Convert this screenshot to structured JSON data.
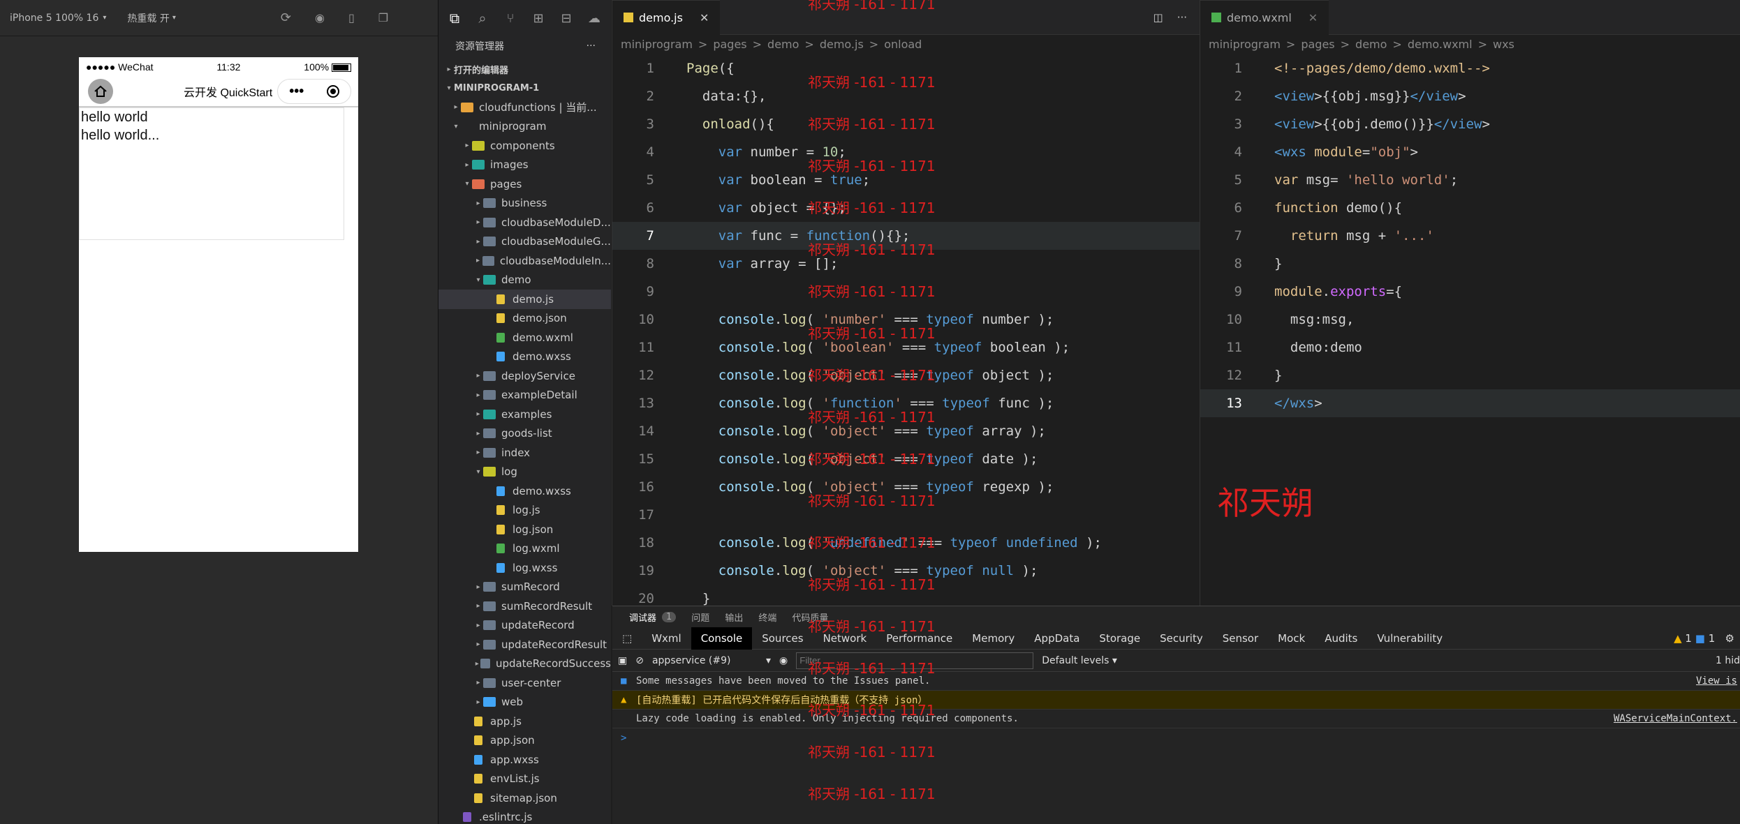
{
  "simulator": {
    "device": "iPhone 5 100% 16",
    "hot_reload": "热重载 开",
    "status_left": "●●●●● WeChat",
    "time": "11:32",
    "battery": "100%",
    "nav_title": "云开发 QuickStart",
    "capsule_menu": "•••",
    "content_lines": [
      "hello world",
      "hello world..."
    ]
  },
  "explorer": {
    "title": "资源管理器",
    "open_editors": "打开的编辑器",
    "project": "MINIPROGRAM-1",
    "items": [
      {
        "label": "cloudfunctions | 当前...",
        "depth": 1,
        "caret": "▸",
        "icon": "folder-cloud",
        "color": "#e8a33c"
      },
      {
        "label": "miniprogram",
        "depth": 1,
        "caret": "▾",
        "icon": "folder",
        "color": ""
      },
      {
        "label": "components",
        "depth": 2,
        "caret": "▸",
        "icon": "folder-components",
        "color": "#c4c42a"
      },
      {
        "label": "images",
        "depth": 2,
        "caret": "▸",
        "icon": "folder-images",
        "color": "#26a69a"
      },
      {
        "label": "pages",
        "depth": 2,
        "caret": "▾",
        "icon": "folder-pages",
        "color": "#e06c4c"
      },
      {
        "label": "business",
        "depth": 3,
        "caret": "▸",
        "icon": "folder",
        "color": "#6b7a8c"
      },
      {
        "label": "cloudbaseModuleD...",
        "depth": 3,
        "caret": "▸",
        "icon": "folder",
        "color": "#6b7a8c"
      },
      {
        "label": "cloudbaseModuleG...",
        "depth": 3,
        "caret": "▸",
        "icon": "folder",
        "color": "#6b7a8c"
      },
      {
        "label": "cloudbaseModuleIn...",
        "depth": 3,
        "caret": "▸",
        "icon": "folder",
        "color": "#6b7a8c"
      },
      {
        "label": "demo",
        "depth": 3,
        "caret": "▾",
        "icon": "folder-demo",
        "color": "#26a69a"
      },
      {
        "label": "demo.js",
        "depth": 4,
        "caret": "",
        "icon": "js-file",
        "color": "#e8c43c",
        "selected": true
      },
      {
        "label": "demo.json",
        "depth": 4,
        "caret": "",
        "icon": "json-file",
        "color": "#e8c43c"
      },
      {
        "label": "demo.wxml",
        "depth": 4,
        "caret": "",
        "icon": "wxml-file",
        "color": "#4caf50"
      },
      {
        "label": "demo.wxss",
        "depth": 4,
        "caret": "",
        "icon": "css-file",
        "color": "#42a5f5"
      },
      {
        "label": "deployService",
        "depth": 3,
        "caret": "▸",
        "icon": "folder",
        "color": "#6b7a8c"
      },
      {
        "label": "exampleDetail",
        "depth": 3,
        "caret": "▸",
        "icon": "folder",
        "color": "#6b7a8c"
      },
      {
        "label": "examples",
        "depth": 3,
        "caret": "▸",
        "icon": "folder-examples",
        "color": "#26a69a"
      },
      {
        "label": "goods-list",
        "depth": 3,
        "caret": "▸",
        "icon": "folder",
        "color": "#6b7a8c"
      },
      {
        "label": "index",
        "depth": 3,
        "caret": "▸",
        "icon": "folder",
        "color": "#6b7a8c"
      },
      {
        "label": "log",
        "depth": 3,
        "caret": "▾",
        "icon": "folder-log",
        "color": "#c4c42a"
      },
      {
        "label": "demo.wxss",
        "depth": 4,
        "caret": "",
        "icon": "css-file",
        "color": "#42a5f5"
      },
      {
        "label": "log.js",
        "depth": 4,
        "caret": "",
        "icon": "js-file",
        "color": "#e8c43c"
      },
      {
        "label": "log.json",
        "depth": 4,
        "caret": "",
        "icon": "json-file",
        "color": "#e8c43c"
      },
      {
        "label": "log.wxml",
        "depth": 4,
        "caret": "",
        "icon": "wxml-file",
        "color": "#4caf50"
      },
      {
        "label": "log.wxss",
        "depth": 4,
        "caret": "",
        "icon": "css-file",
        "color": "#42a5f5"
      },
      {
        "label": "sumRecord",
        "depth": 3,
        "caret": "▸",
        "icon": "folder",
        "color": "#6b7a8c"
      },
      {
        "label": "sumRecordResult",
        "depth": 3,
        "caret": "▸",
        "icon": "folder",
        "color": "#6b7a8c"
      },
      {
        "label": "updateRecord",
        "depth": 3,
        "caret": "▸",
        "icon": "folder",
        "color": "#6b7a8c"
      },
      {
        "label": "updateRecordResult",
        "depth": 3,
        "caret": "▸",
        "icon": "folder",
        "color": "#6b7a8c"
      },
      {
        "label": "updateRecordSuccess",
        "depth": 3,
        "caret": "▸",
        "icon": "folder",
        "color": "#6b7a8c"
      },
      {
        "label": "user-center",
        "depth": 3,
        "caret": "▸",
        "icon": "folder",
        "color": "#6b7a8c"
      },
      {
        "label": "web",
        "depth": 3,
        "caret": "▸",
        "icon": "folder-web",
        "color": "#42a5f5"
      },
      {
        "label": "app.js",
        "depth": 2,
        "caret": "",
        "icon": "js-file",
        "color": "#e8c43c"
      },
      {
        "label": "app.json",
        "depth": 2,
        "caret": "",
        "icon": "json-file",
        "color": "#e8c43c"
      },
      {
        "label": "app.wxss",
        "depth": 2,
        "caret": "",
        "icon": "css-file",
        "color": "#42a5f5"
      },
      {
        "label": "envList.js",
        "depth": 2,
        "caret": "",
        "icon": "js-file",
        "color": "#e8c43c"
      },
      {
        "label": "sitemap.json",
        "depth": 2,
        "caret": "",
        "icon": "json-file",
        "color": "#e8c43c"
      },
      {
        "label": ".eslintrc.js",
        "depth": 1,
        "caret": "",
        "icon": "eslint-file",
        "color": "#7e57c2"
      }
    ]
  },
  "editor_js": {
    "tab": "demo.js",
    "crumbs": [
      "miniprogram",
      ">",
      "pages",
      ">",
      "demo",
      ">",
      "demo.js",
      ">",
      "onload"
    ],
    "lines": [
      {
        "n": "1",
        "code": "Page({"
      },
      {
        "n": "2",
        "code": "  data:{},"
      },
      {
        "n": "3",
        "code": "  onload(){"
      },
      {
        "n": "4",
        "code": "    var number = 10;"
      },
      {
        "n": "5",
        "code": "    var boolean = true;"
      },
      {
        "n": "6",
        "code": "    var object = {};"
      },
      {
        "n": "7",
        "code": "    var func = function(){};"
      },
      {
        "n": "8",
        "code": "    var array = [];"
      },
      {
        "n": "9",
        "code": ""
      },
      {
        "n": "10",
        "code": "    console.log( 'number' === typeof number );"
      },
      {
        "n": "11",
        "code": "    console.log( 'boolean' === typeof boolean );"
      },
      {
        "n": "12",
        "code": "    console.log( 'object' === typeof object );"
      },
      {
        "n": "13",
        "code": "    console.log( 'function' === typeof func );"
      },
      {
        "n": "14",
        "code": "    console.log( 'object' === typeof array );"
      },
      {
        "n": "15",
        "code": "    console.log( 'object' === typeof date );"
      },
      {
        "n": "16",
        "code": "    console.log( 'object' === typeof regexp );"
      },
      {
        "n": "17",
        "code": ""
      },
      {
        "n": "18",
        "code": "    console.log( 'undefined' === typeof undefined );"
      },
      {
        "n": "19",
        "code": "    console.log( 'object' === typeof null );"
      },
      {
        "n": "20",
        "code": "  }"
      }
    ]
  },
  "editor_wxml": {
    "tab": "demo.wxml",
    "crumbs": [
      "miniprogram",
      ">",
      "pages",
      ">",
      "demo",
      ">",
      "demo.wxml",
      ">",
      "wxs"
    ],
    "lines": [
      {
        "n": "1",
        "code": "<!--pages/demo/demo.wxml-->"
      },
      {
        "n": "2",
        "code": "<view>{{obj.msg}}</view>"
      },
      {
        "n": "3",
        "code": "<view>{{obj.demo()}}</view>"
      },
      {
        "n": "4",
        "code": "<wxs module=\"obj\">"
      },
      {
        "n": "5",
        "code": "var msg= 'hello world';"
      },
      {
        "n": "6",
        "code": "function demo(){"
      },
      {
        "n": "7",
        "code": "  return msg + '...'"
      },
      {
        "n": "8",
        "code": "}"
      },
      {
        "n": "9",
        "code": "module.exports={"
      },
      {
        "n": "10",
        "code": "  msg:msg,"
      },
      {
        "n": "11",
        "code": "  demo:demo"
      },
      {
        "n": "12",
        "code": "}"
      },
      {
        "n": "13",
        "code": "</wxs>"
      }
    ],
    "signature": "祁天朔"
  },
  "devtools": {
    "top_tabs": [
      "调试器",
      "问题",
      "输出",
      "终端",
      "代码质量"
    ],
    "badge": "1",
    "tabs": [
      "Wxml",
      "Console",
      "Sources",
      "Network",
      "Performance",
      "Memory",
      "AppData",
      "Storage",
      "Security",
      "Sensor",
      "Mock",
      "Audits",
      "Vulnerability"
    ],
    "active_tab": "Console",
    "warn_count": "1",
    "info_count": "1",
    "context": "appservice (#9)",
    "filter_placeholder": "Filter",
    "levels": "Default levels",
    "hidden": "1 hid",
    "messages": [
      {
        "text": "Some messages have been moved to the Issues panel.",
        "link": "View is",
        "type": "info"
      },
      {
        "text": "[自动热重载] 已开启代码文件保存后自动热重载（不支持 json）",
        "link": "",
        "type": "warn"
      },
      {
        "text": "Lazy code loading is enabled. Only injecting required components.",
        "link": "WAServiceMainContext.",
        "type": "log"
      }
    ],
    "prompt": ">"
  },
  "watermark": "祁天朔 -161 - 1171"
}
